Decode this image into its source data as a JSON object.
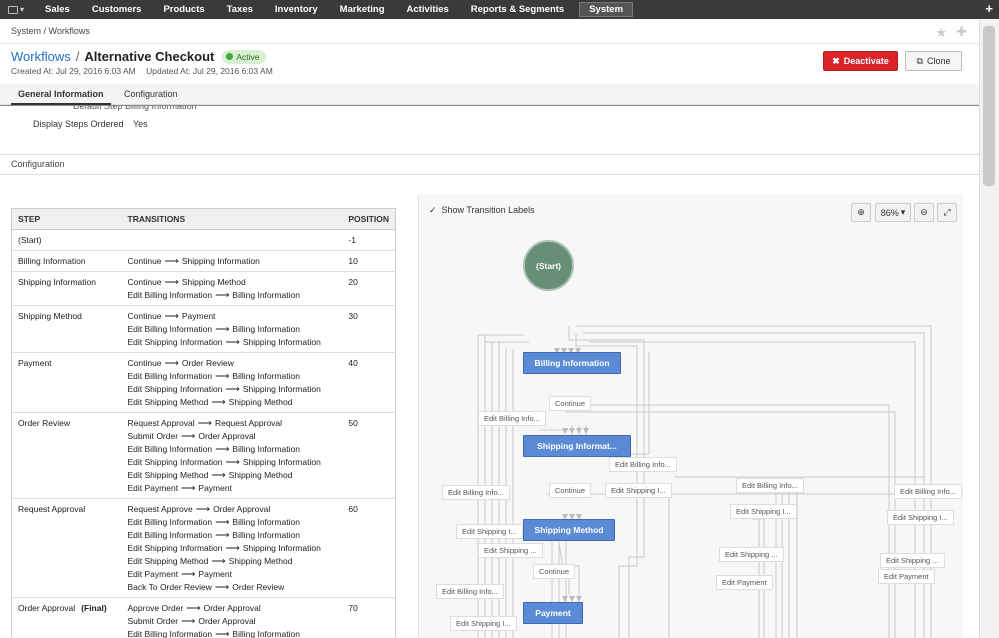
{
  "topnav": {
    "apps_icon": "bar-chart-icon",
    "items": [
      "Sales",
      "Customers",
      "Products",
      "Taxes",
      "Inventory",
      "Marketing",
      "Activities",
      "Reports & Segments",
      "System"
    ],
    "active": "System",
    "plus": "+"
  },
  "breadcrumb": "System / Workflows",
  "header": {
    "crumb": "Workflows",
    "sep": "/",
    "title": "Alternative Checkout",
    "status": "Active",
    "created": "Created At: Jul 29, 2016 6:03 AM",
    "updated": "Updated At: Jul 29, 2016 6:03 AM",
    "deactivate_label": "Deactivate",
    "clone_label": "Clone"
  },
  "tabs": [
    "General Information",
    "Configuration"
  ],
  "general": {
    "partial_text": "Default Step    Billing Information",
    "display_steps_label": "Display Steps Ordered",
    "display_steps_value": "Yes"
  },
  "section_title": "Configuration",
  "table": {
    "headers": [
      "STEP",
      "TRANSITIONS",
      "POSITION"
    ],
    "rows": [
      {
        "step": "(Start)",
        "transitions": [],
        "position": "-1"
      },
      {
        "step": "Billing Information",
        "transitions": [
          [
            "Continue",
            "Shipping Information"
          ]
        ],
        "position": "10"
      },
      {
        "step": "Shipping Information",
        "transitions": [
          [
            "Continue",
            "Shipping Method"
          ],
          [
            "Edit Billing Information",
            "Billing Information"
          ]
        ],
        "position": "20"
      },
      {
        "step": "Shipping Method",
        "transitions": [
          [
            "Continue",
            "Payment"
          ],
          [
            "Edit Billing Information",
            "Billing Information"
          ],
          [
            "Edit Shipping Information",
            "Shipping Information"
          ]
        ],
        "position": "30"
      },
      {
        "step": "Payment",
        "transitions": [
          [
            "Continue",
            "Order Review"
          ],
          [
            "Edit Billing Information",
            "Billing Information"
          ],
          [
            "Edit Shipping Information",
            "Shipping Information"
          ],
          [
            "Edit Shipping Method",
            "Shipping Method"
          ]
        ],
        "position": "40"
      },
      {
        "step": "Order Review",
        "transitions": [
          [
            "Request Approval",
            "Request Approval"
          ],
          [
            "Submit Order",
            "Order Approval"
          ],
          [
            "Edit Billing Information",
            "Billing Information"
          ],
          [
            "Edit Shipping Information",
            "Shipping Information"
          ],
          [
            "Edit Shipping Method",
            "Shipping Method"
          ],
          [
            "Edit Payment",
            "Payment"
          ]
        ],
        "position": "50"
      },
      {
        "step": "Request Approval",
        "transitions": [
          [
            "Request Approve",
            "Order Approval"
          ],
          [
            "Edit Billing Information",
            "Billing Information"
          ],
          [
            "Edit Billing Information",
            "Billing Information"
          ],
          [
            "Edit Shipping Information",
            "Shipping Information"
          ],
          [
            "Edit Shipping Method",
            "Shipping Method"
          ],
          [
            "Edit Payment",
            "Payment"
          ],
          [
            "Back To Order Review",
            "Order Review"
          ]
        ],
        "position": "60"
      },
      {
        "step": "Order Approval",
        "final": "(Final)",
        "transitions": [
          [
            "Approve Order",
            "Order Approval"
          ],
          [
            "Submit Order",
            "Order Approval"
          ],
          [
            "Edit Billing Information",
            "Billing Information"
          ]
        ],
        "position": "70"
      }
    ]
  },
  "diagram": {
    "show_labels_check": "✓",
    "show_labels": "Show Transition Labels",
    "zoom": "86%",
    "start": "(Start)",
    "nodes": [
      "Billing Information",
      "Shipping Informat...",
      "Shipping Method",
      "Payment"
    ],
    "labels": [
      "Continue",
      "Edit Billing Info...",
      "Edit Billing Info...",
      "Continue",
      "Edit Billing Info...",
      "Edit Shipping I...",
      "Edit Billing Info...",
      "Edit Shipping I...",
      "Edit Billing Info...",
      "Edit Shipping I...",
      "Edit Shipping I...",
      "Edit Shipping ...",
      "Edit Shipping ...",
      "Continue",
      "Edit Payment",
      "Edit Payment",
      "Edit Billing Info...",
      "Edit Shipping I..."
    ]
  }
}
